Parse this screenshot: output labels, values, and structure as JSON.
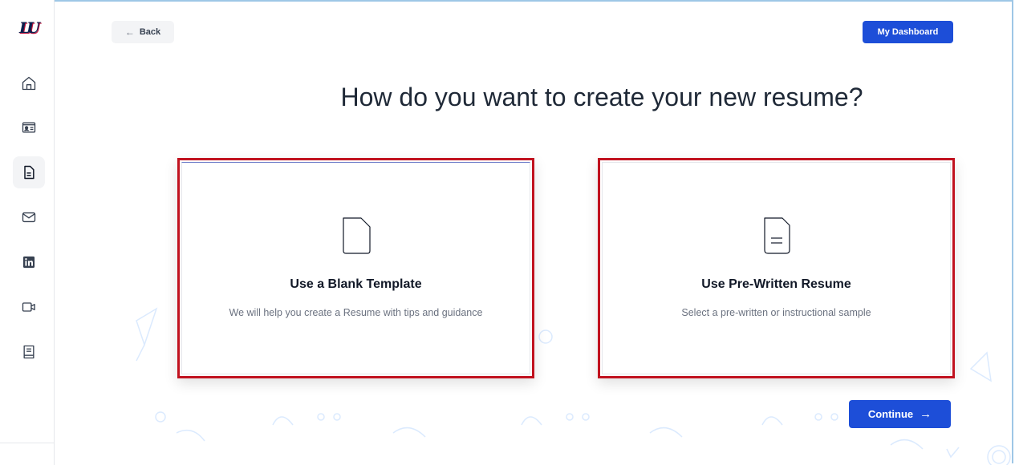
{
  "sidebar": {
    "logo_text": "LU",
    "items": [
      {
        "name": "home",
        "icon": "home-icon"
      },
      {
        "name": "profile-card",
        "icon": "id-card-icon"
      },
      {
        "name": "resume",
        "icon": "document-icon",
        "active": true
      },
      {
        "name": "mail",
        "icon": "mail-icon"
      },
      {
        "name": "linkedin",
        "icon": "linkedin-icon"
      },
      {
        "name": "video",
        "icon": "video-icon"
      },
      {
        "name": "guide",
        "icon": "book-icon"
      }
    ]
  },
  "header": {
    "back_arrow": "←",
    "back_label": "Back",
    "dashboard_label": "My Dashboard"
  },
  "main": {
    "title": "How do you want to create your new resume?",
    "options": [
      {
        "title": "Use a Blank Template",
        "description": "We will help you create a Resume with tips and guidance",
        "icon": "blank-file-icon"
      },
      {
        "title": "Use Pre-Written Resume",
        "description": "Select a pre-written or instructional sample",
        "icon": "prewritten-file-icon"
      }
    ],
    "continue_label": "Continue",
    "continue_arrow": "→"
  },
  "colors": {
    "accent": "#1d4ed8",
    "highlight_border": "#c1121f",
    "text_dark": "#1f2937",
    "text_muted": "#6b7280"
  }
}
